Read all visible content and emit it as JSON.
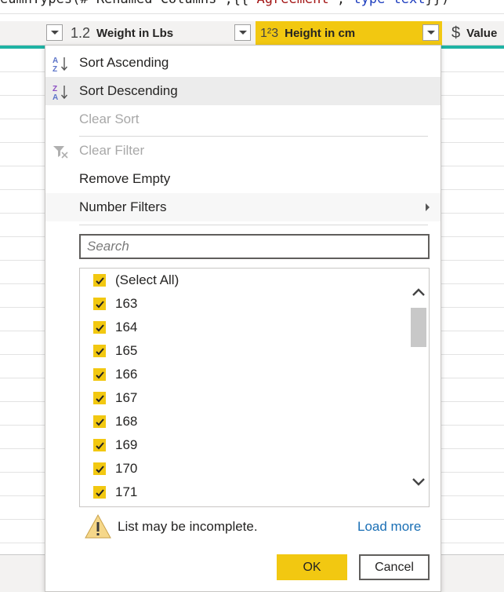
{
  "formula_bar": {
    "prefix": "eumnTypes(#\"Renamed Columns\",{{",
    "string_literal": "\"Agreement\"",
    "separator": ", ",
    "keyword": "type text",
    "suffix": "}})"
  },
  "columns": {
    "weight": {
      "type_icon": "1.2",
      "label": "Weight in Lbs"
    },
    "height": {
      "type_icon": "1²3",
      "label": "Height in cm"
    },
    "value": {
      "type_icon": "$",
      "label": "Value"
    }
  },
  "menu": {
    "sort_ascending": "Sort Ascending",
    "sort_descending": "Sort Descending",
    "clear_sort": "Clear Sort",
    "clear_filter": "Clear Filter",
    "remove_empty": "Remove Empty",
    "number_filters": "Number Filters"
  },
  "search": {
    "placeholder": "Search"
  },
  "list_items": [
    {
      "label": "(Select All)",
      "checked": true
    },
    {
      "label": "163",
      "checked": true
    },
    {
      "label": "164",
      "checked": true
    },
    {
      "label": "165",
      "checked": true
    },
    {
      "label": "166",
      "checked": true
    },
    {
      "label": "167",
      "checked": true
    },
    {
      "label": "168",
      "checked": true
    },
    {
      "label": "169",
      "checked": true
    },
    {
      "label": "170",
      "checked": true
    },
    {
      "label": "171",
      "checked": true
    }
  ],
  "warning": {
    "text": "List may be incomplete.",
    "link": "Load more"
  },
  "buttons": {
    "ok": "OK",
    "cancel": "Cancel"
  },
  "colors": {
    "accent": "#f2c811",
    "teal": "#1fb3a4",
    "link": "#1a6fb5"
  },
  "icons": {
    "sort_ascending": "sort-ascending-icon",
    "sort_descending": "sort-descending-icon",
    "clear_filter": "clear-filter-icon",
    "submenu": "chevron-right-icon",
    "warning": "warning-icon",
    "scroll_up": "chevron-up-icon",
    "scroll_down": "chevron-down-icon"
  }
}
